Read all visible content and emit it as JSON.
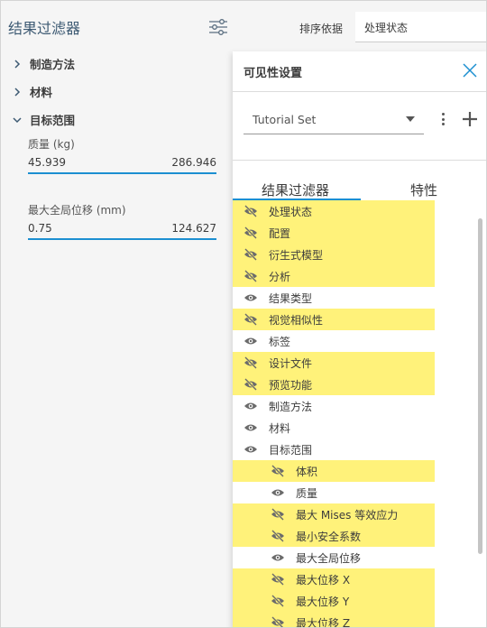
{
  "left_panel": {
    "title": "结果过滤器",
    "sections": [
      {
        "label": "制造方法",
        "expanded": false
      },
      {
        "label": "材料",
        "expanded": false
      },
      {
        "label": "目标范围",
        "expanded": true
      }
    ],
    "ranges": [
      {
        "label": "质量 (kg)",
        "min": "45.939",
        "max": "286.946"
      },
      {
        "label": "最大全局位移 (mm)",
        "min": "0.75",
        "max": "124.627"
      }
    ]
  },
  "top_bar": {
    "sort_label": "排序依据",
    "sort_value": "处理状态"
  },
  "popup": {
    "title": "可见性设置",
    "set_dropdown": "Tutorial Set",
    "tabs": [
      "结果过滤器",
      "特性"
    ],
    "items": [
      {
        "label": "处理状态",
        "visible": false
      },
      {
        "label": "配置",
        "visible": false
      },
      {
        "label": "衍生式模型",
        "visible": false
      },
      {
        "label": "分析",
        "visible": false
      },
      {
        "label": "结果类型",
        "visible": true
      },
      {
        "label": "视觉相似性",
        "visible": false
      },
      {
        "label": "标签",
        "visible": true
      },
      {
        "label": "设计文件",
        "visible": false
      },
      {
        "label": "预览功能",
        "visible": false
      },
      {
        "label": "制造方法",
        "visible": true
      },
      {
        "label": "材料",
        "visible": true
      },
      {
        "label": "目标范围",
        "visible": true
      },
      {
        "label": "体积",
        "visible": false,
        "indent": true
      },
      {
        "label": "质量",
        "visible": true,
        "indent": true
      },
      {
        "label": "最大 Mises 等效应力",
        "visible": false,
        "indent": true
      },
      {
        "label": "最小安全系数",
        "visible": false,
        "indent": true
      },
      {
        "label": "最大全局位移",
        "visible": true,
        "indent": true
      },
      {
        "label": "最大位移 X",
        "visible": false,
        "indent": true
      },
      {
        "label": "最大位移 Y",
        "visible": false,
        "indent": true
      },
      {
        "label": "最大位移 Z",
        "visible": false,
        "indent": true
      }
    ]
  },
  "colors": {
    "accent": "#1c8fd1",
    "highlight": "#fff27a",
    "title_text": "#3d5a73"
  }
}
